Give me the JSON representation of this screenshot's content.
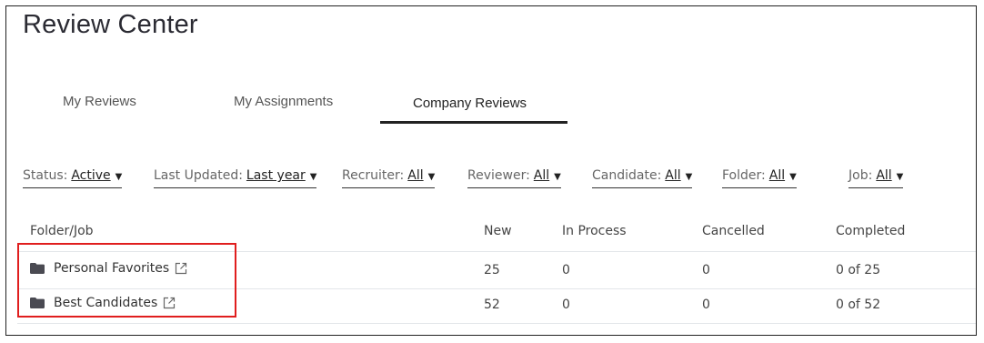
{
  "page": {
    "title": "Review Center"
  },
  "tabs": [
    {
      "label": "My Reviews"
    },
    {
      "label": "My Assignments"
    },
    {
      "label": "Company Reviews",
      "active": true
    }
  ],
  "filters": [
    {
      "label": "Status:",
      "value": "Active"
    },
    {
      "label": "Last Updated:",
      "value": "Last year"
    },
    {
      "label": "Recruiter:",
      "value": "All"
    },
    {
      "label": "Reviewer:",
      "value": "All"
    },
    {
      "label": "Candidate:",
      "value": "All"
    },
    {
      "label": "Folder:",
      "value": "All"
    },
    {
      "label": "Job:",
      "value": "All"
    }
  ],
  "table": {
    "headers": [
      "Folder/Job",
      "New",
      "In Process",
      "Cancelled",
      "Completed"
    ],
    "rows": [
      {
        "name": "Personal Favorites",
        "new": "25",
        "in_process": "0",
        "cancelled": "0",
        "completed": "0 of 25"
      },
      {
        "name": "Best Candidates",
        "new": "52",
        "in_process": "0",
        "cancelled": "0",
        "completed": "0 of 52"
      }
    ]
  },
  "icons": {
    "folder": "folder-icon",
    "external": "external-link-icon",
    "caret": "caret-down-icon"
  },
  "colors": {
    "highlight": "#e01e1e",
    "active_tab_underline": "#222222"
  }
}
